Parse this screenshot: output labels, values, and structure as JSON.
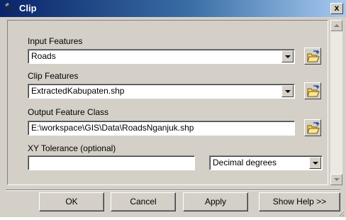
{
  "window": {
    "title": "Clip",
    "icon": "arctoolbox-tool-icon",
    "close_label": "x"
  },
  "form": {
    "input_features": {
      "label": "Input Features",
      "value": "Roads"
    },
    "clip_features": {
      "label": "Clip Features",
      "value": "ExtractedKabupaten.shp"
    },
    "output_feature_class": {
      "label": "Output Feature Class",
      "value": "E:\\workspace\\GIS\\Data\\RoadsNganjuk.shp"
    },
    "xy_tolerance": {
      "label": "XY Tolerance (optional)",
      "value": "",
      "unit": "Decimal degrees"
    }
  },
  "buttons": {
    "ok": "OK",
    "cancel": "Cancel",
    "apply": "Apply",
    "show_help": "Show Help >>"
  },
  "colors": {
    "titlebar_start": "#0a246a",
    "titlebar_end": "#a6caf0",
    "dialog_face": "#d4d0c8"
  }
}
